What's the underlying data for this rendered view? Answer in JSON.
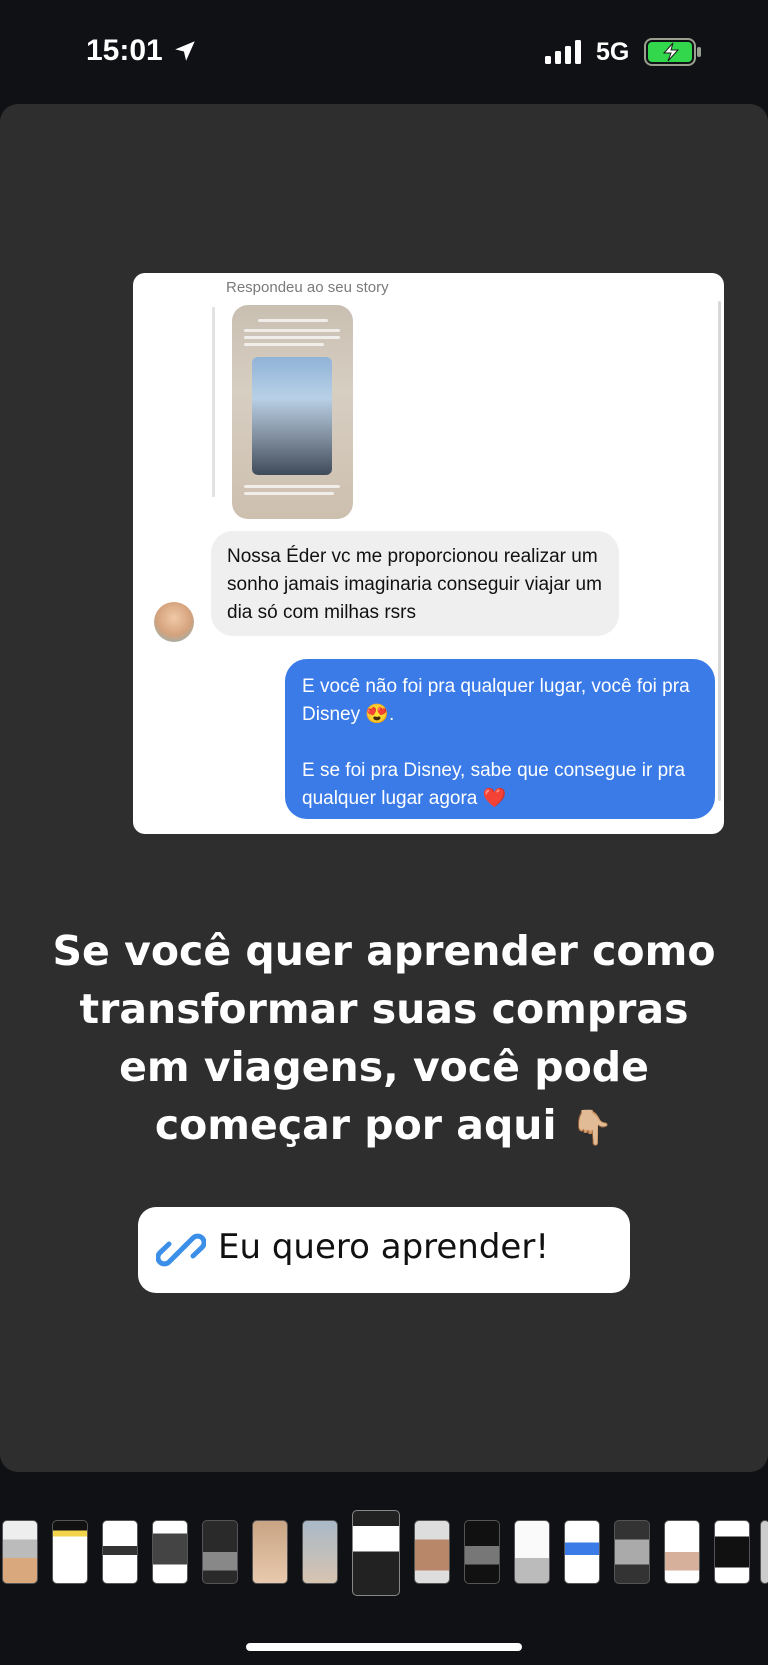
{
  "status_bar": {
    "time": "15:01",
    "network": "5G",
    "location_icon": "location-arrow-icon",
    "signal_icon": "signal-bars-icon",
    "battery_icon": "battery-charging-icon",
    "battery_color": "#32d74b"
  },
  "chat": {
    "reply_caption": "Respondeu ao seu story",
    "incoming_message": "Nossa Éder vc me proporcionou realizar um sonho jamais imaginaria conseguir viajar um dia só com milhas rsrs",
    "outgoing_paragraph_1": "E você não foi pra qualquer lugar, você foi pra Disney 😍.",
    "outgoing_paragraph_2": "E se foi pra Disney, sabe que consegue ir pra qualquer lugar agora ❤️",
    "outgoing_bubble_color": "#3a7be8"
  },
  "headline": {
    "text": "Se você quer aprender como transformar suas compras em viagens, você pode começar por aqui",
    "emoji": "👇🏼"
  },
  "link_sticker": {
    "label": "Eu quero aprender!",
    "icon": "link-icon",
    "icon_color": "#3b8fe8"
  },
  "story_thumbnails": {
    "count": 16,
    "active_index": 7
  }
}
